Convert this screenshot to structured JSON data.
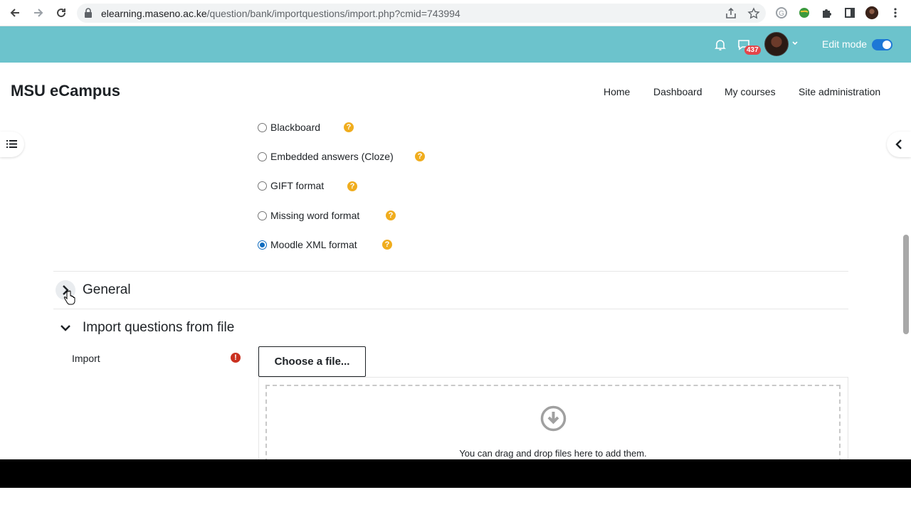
{
  "browser": {
    "url_host": "elearning.maseno.ac.ke",
    "url_path": "/question/bank/importquestions/import.php?cmid=743994"
  },
  "topbar": {
    "chat_badge": "437",
    "edit_mode_label": "Edit mode",
    "edit_mode_on": true,
    "bg_color": "#6cc3cc"
  },
  "site": {
    "name": "MSU eCampus",
    "nav": [
      "Home",
      "Dashboard",
      "My courses",
      "Site administration"
    ]
  },
  "formats": [
    {
      "label": "Blackboard",
      "checked": false
    },
    {
      "label": "Embedded answers (Cloze)",
      "checked": false
    },
    {
      "label": "GIFT format",
      "checked": false
    },
    {
      "label": "Missing word format",
      "checked": false
    },
    {
      "label": "Moodle XML format",
      "checked": true
    }
  ],
  "help_glyph": "?",
  "sections": {
    "general": "General",
    "import_from_file": "Import questions from file"
  },
  "import": {
    "label": "Import",
    "required_glyph": "!",
    "choose_button": "Choose a file...",
    "drop_text": "You can drag and drop files here to add them."
  }
}
